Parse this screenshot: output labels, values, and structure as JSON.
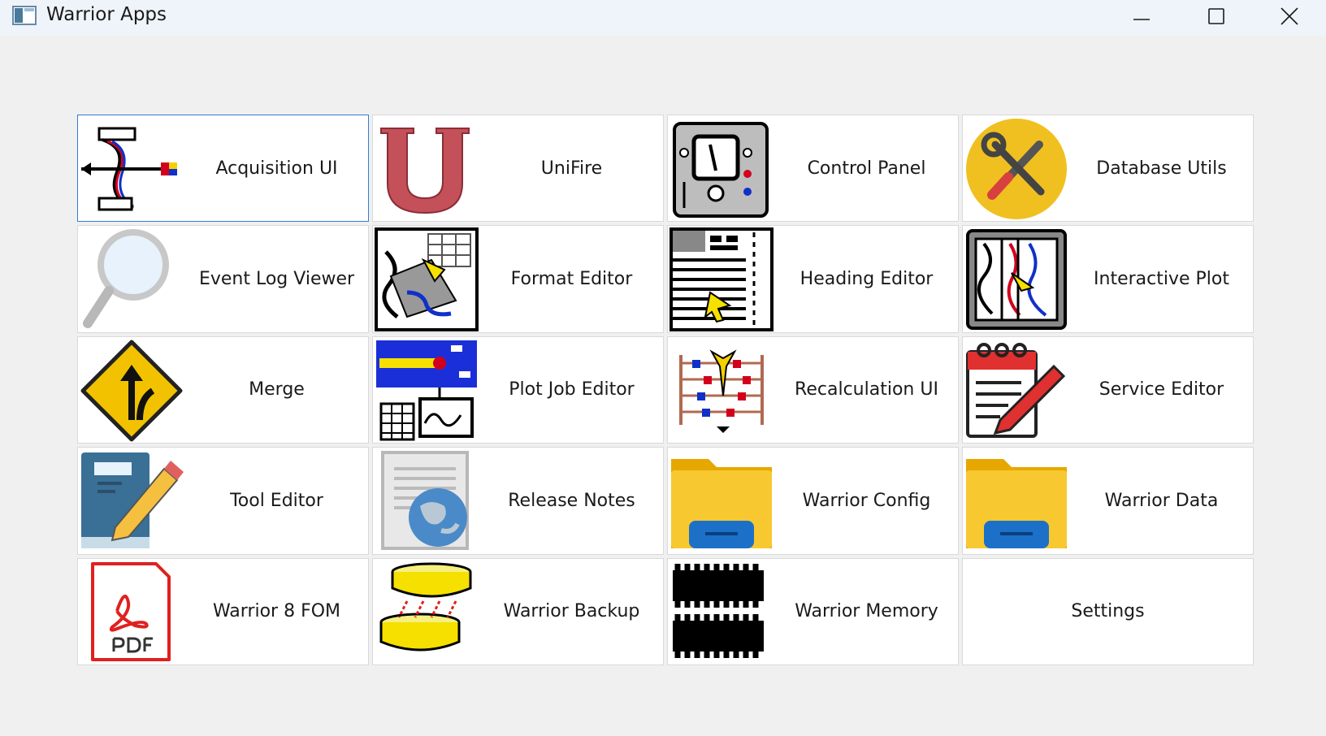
{
  "window": {
    "title": "Warrior Apps"
  },
  "tiles": [
    {
      "label": "Acquisition UI",
      "icon": "acquisition-icon"
    },
    {
      "label": "UniFire",
      "icon": "unifire-u-icon"
    },
    {
      "label": "Control Panel",
      "icon": "control-panel-icon"
    },
    {
      "label": "Database Utils",
      "icon": "tools-icon"
    },
    {
      "label": "Event Log Viewer",
      "icon": "magnifier-icon"
    },
    {
      "label": "Format Editor",
      "icon": "format-editor-icon"
    },
    {
      "label": "Heading Editor",
      "icon": "heading-editor-icon"
    },
    {
      "label": "Interactive Plot",
      "icon": "interactive-plot-icon"
    },
    {
      "label": "Merge",
      "icon": "merge-sign-icon"
    },
    {
      "label": "Plot Job Editor",
      "icon": "plot-job-icon"
    },
    {
      "label": "Recalculation UI",
      "icon": "abacus-icon"
    },
    {
      "label": "Service Editor",
      "icon": "calendar-pencil-icon"
    },
    {
      "label": "Tool Editor",
      "icon": "book-pencil-icon"
    },
    {
      "label": "Release Notes",
      "icon": "document-globe-icon"
    },
    {
      "label": "Warrior Config",
      "icon": "folder-icon"
    },
    {
      "label": "Warrior Data",
      "icon": "folder-icon"
    },
    {
      "label": "Warrior 8 FOM",
      "icon": "pdf-icon"
    },
    {
      "label": "Warrior Backup",
      "icon": "backup-disks-icon"
    },
    {
      "label": "Warrior Memory",
      "icon": "memory-chip-icon"
    },
    {
      "label": "Settings",
      "icon": ""
    }
  ],
  "colors": {
    "selected_border": "#2d7fd3",
    "tile_border": "#d9d9d9",
    "background": "#f0f0f0"
  }
}
